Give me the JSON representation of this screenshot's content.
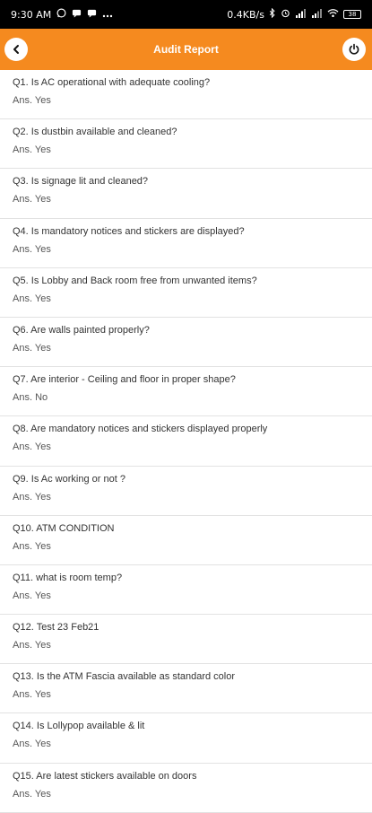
{
  "status_bar": {
    "time": "9:30 AM",
    "network_speed": "0.4KB/s",
    "battery": "38"
  },
  "app_bar": {
    "title": "Audit Report",
    "back_icon": "back-arrow-icon",
    "power_icon": "power-icon"
  },
  "answer_prefix": "Ans.",
  "items": [
    {
      "question": "Q1. Is AC operational with adequate cooling?",
      "answer": "Ans. Yes"
    },
    {
      "question": "Q2. Is dustbin available and cleaned?",
      "answer": "Ans. Yes"
    },
    {
      "question": "Q3. Is signage lit and cleaned?",
      "answer": "Ans. Yes"
    },
    {
      "question": "Q4. Is mandatory notices and stickers are displayed?",
      "answer": "Ans. Yes"
    },
    {
      "question": "Q5. Is Lobby and Back room free from unwanted items?",
      "answer": "Ans. Yes"
    },
    {
      "question": "Q6. Are walls painted properly?",
      "answer": "Ans. Yes"
    },
    {
      "question": "Q7. Are interior - Ceiling and floor in proper shape?",
      "answer": "Ans. No"
    },
    {
      "question": "Q8. Are mandatory notices and stickers displayed properly",
      "answer": "Ans. Yes"
    },
    {
      "question": "Q9. Is Ac working or not ?",
      "answer": "Ans. Yes"
    },
    {
      "question": "Q10. ATM CONDITION",
      "answer": "Ans. Yes"
    },
    {
      "question": "Q11. what is room temp?",
      "answer": "Ans. Yes"
    },
    {
      "question": "Q12. Test 23 Feb21",
      "answer": "Ans. Yes"
    },
    {
      "question": "Q13. Is the ATM Fascia available as standard color",
      "answer": "Ans. Yes"
    },
    {
      "question": "Q14. Is Lollypop available & lit",
      "answer": "Ans. Yes"
    },
    {
      "question": "Q15. Are latest stickers available on doors",
      "answer": "Ans. Yes"
    }
  ],
  "colors": {
    "app_bar": "#f58a1f",
    "status_bar": "#000000",
    "divider": "#e2e2e2"
  }
}
